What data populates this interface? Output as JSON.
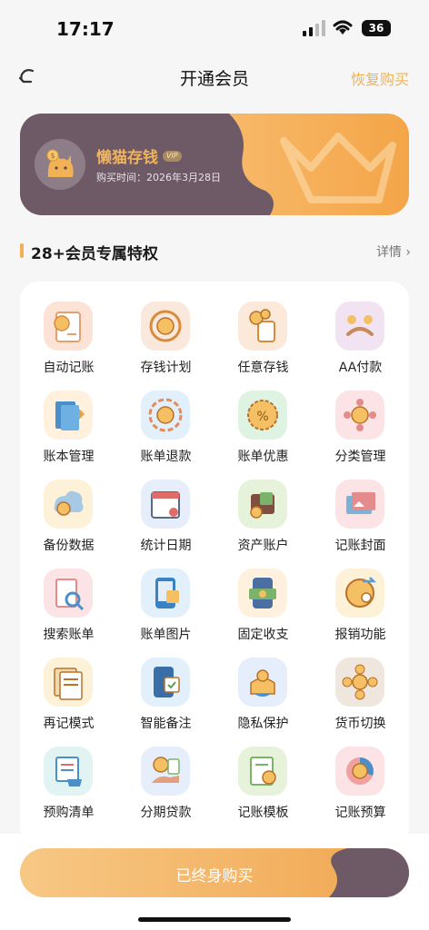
{
  "status": {
    "time": "17:17",
    "battery": "36"
  },
  "nav": {
    "title": "开通会员",
    "restore": "恢复购买"
  },
  "vip": {
    "name": "懒猫存钱",
    "badge": "VIP",
    "purchase_date": "购买时间：2026年3月28日"
  },
  "section": {
    "title": "28+会员专属特权",
    "detail": "详情"
  },
  "features": [
    {
      "label": "自动记账",
      "icon": "auto-bookkeeping-icon",
      "bg": "#fde3d6"
    },
    {
      "label": "存钱计划",
      "icon": "savings-plan-icon",
      "bg": "#fbe8dc"
    },
    {
      "label": "任意存钱",
      "icon": "any-savings-icon",
      "bg": "#fde9d9"
    },
    {
      "label": "AA付款",
      "icon": "aa-payment-icon",
      "bg": "#f1e3f1"
    },
    {
      "label": "账本管理",
      "icon": "ledger-manage-icon",
      "bg": "#fff1dd"
    },
    {
      "label": "账单退款",
      "icon": "bill-refund-icon",
      "bg": "#e1f0fb"
    },
    {
      "label": "账单优惠",
      "icon": "bill-discount-icon",
      "bg": "#dff3e2"
    },
    {
      "label": "分类管理",
      "icon": "category-manage-icon",
      "bg": "#fbe3e6"
    },
    {
      "label": "备份数据",
      "icon": "backup-data-icon",
      "bg": "#fdf2d8"
    },
    {
      "label": "统计日期",
      "icon": "stat-date-icon",
      "bg": "#e6edfb"
    },
    {
      "label": "资产账户",
      "icon": "asset-account-icon",
      "bg": "#e6f3da"
    },
    {
      "label": "记账封面",
      "icon": "ledger-cover-icon",
      "bg": "#fbe3e6"
    },
    {
      "label": "搜索账单",
      "icon": "search-bill-icon",
      "bg": "#fbe3e6"
    },
    {
      "label": "账单图片",
      "icon": "bill-image-icon",
      "bg": "#e1f0fb"
    },
    {
      "label": "固定收支",
      "icon": "fixed-income-icon",
      "bg": "#fff1dd"
    },
    {
      "label": "报销功能",
      "icon": "reimburse-icon",
      "bg": "#fdf2d8"
    },
    {
      "label": "再记模式",
      "icon": "re-record-icon",
      "bg": "#fdf2d8"
    },
    {
      "label": "智能备注",
      "icon": "smart-note-icon",
      "bg": "#e1f0fb"
    },
    {
      "label": "隐私保护",
      "icon": "privacy-icon",
      "bg": "#e6edfb"
    },
    {
      "label": "货币切换",
      "icon": "currency-switch-icon",
      "bg": "#efe6de"
    },
    {
      "label": "预购清单",
      "icon": "pre-purchase-icon",
      "bg": "#e1f3f3"
    },
    {
      "label": "分期贷款",
      "icon": "installment-icon",
      "bg": "#e6edfb"
    },
    {
      "label": "记账模板",
      "icon": "ledger-template-icon",
      "bg": "#e6f3da"
    },
    {
      "label": "记账预算",
      "icon": "budget-icon",
      "bg": "#fbe3e6"
    }
  ],
  "buy": {
    "label": "已终身购买"
  },
  "colors": {
    "accent": "#f2b155",
    "dark": "#6d5a66"
  }
}
